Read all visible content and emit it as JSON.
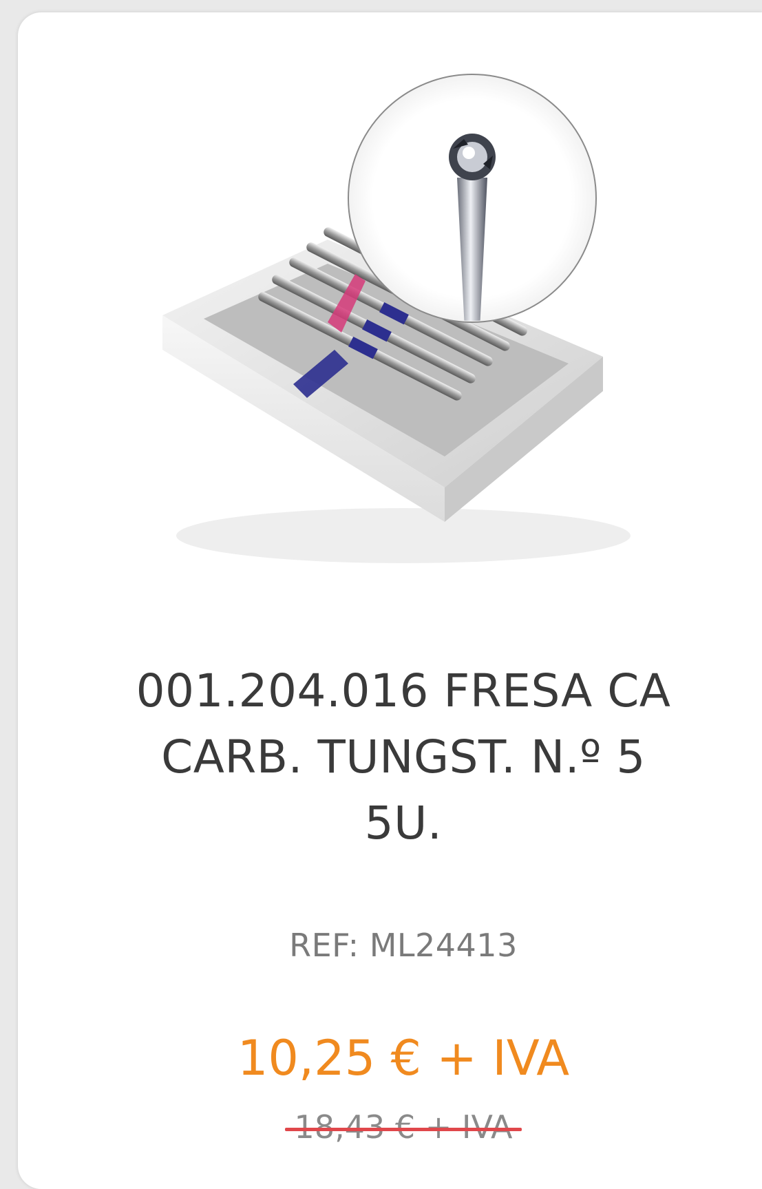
{
  "product": {
    "title": "001.204.016 FRESA CA\nCARB. TUNGST. N.º 5\n5U.",
    "ref": "REF: ML24413",
    "price_current": "10,25 € + IVA",
    "price_old": "18,43 € + IVA"
  },
  "colors": {
    "price_current": "#f08a1f",
    "strike": "#e0474b",
    "title": "#3a3a3a",
    "ref": "#7a7a7a"
  }
}
